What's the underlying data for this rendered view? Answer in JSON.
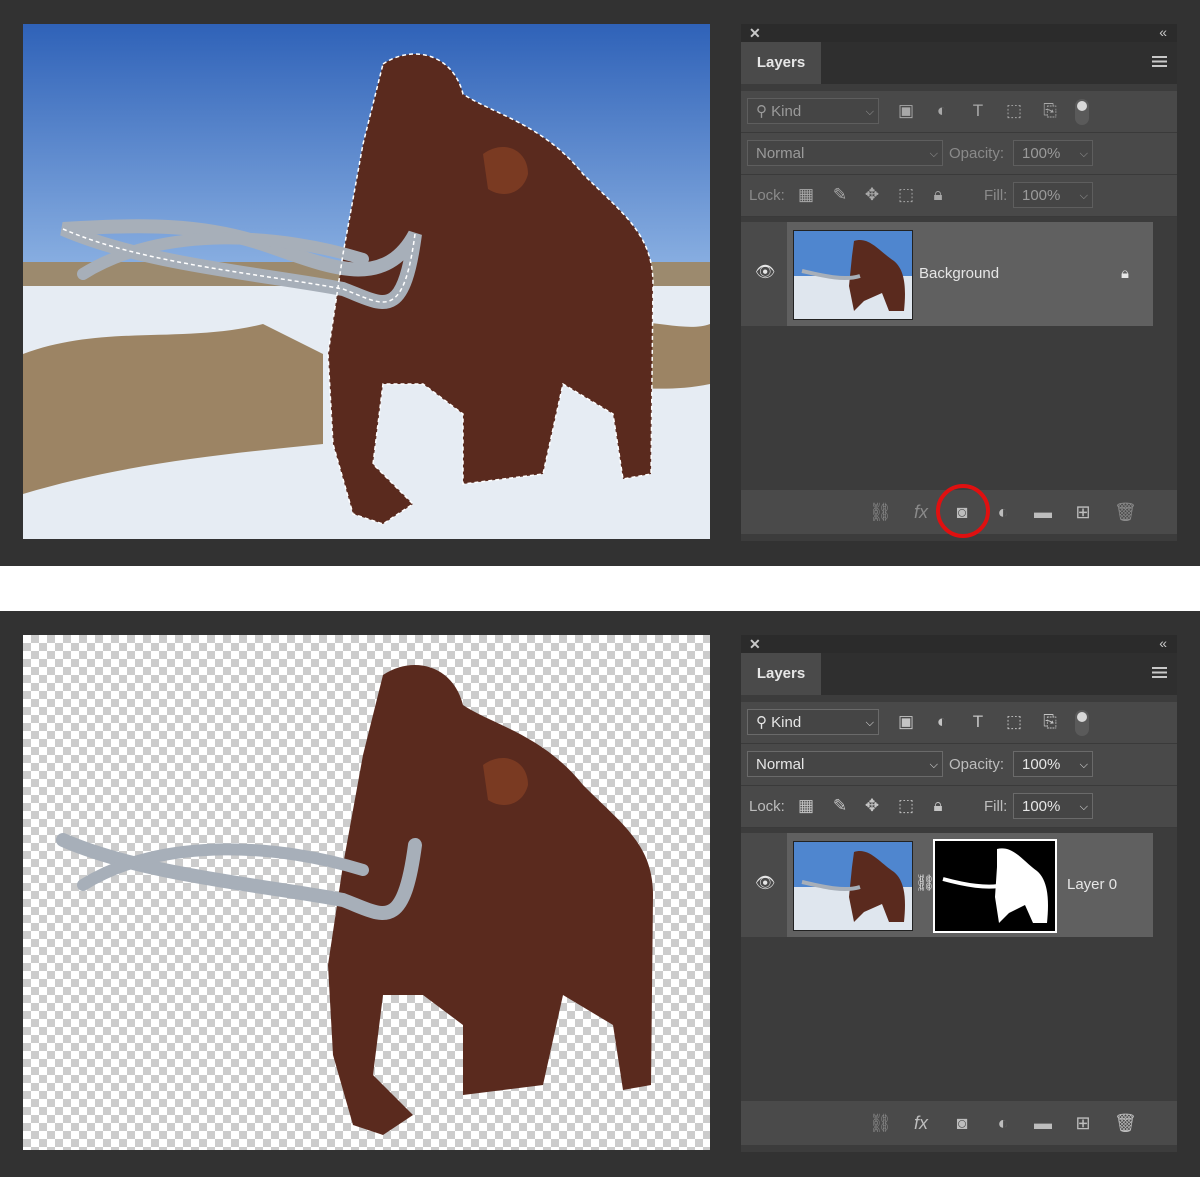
{
  "panels": [
    {
      "id": "before",
      "tab_label": "Layers",
      "kind_label": "Kind",
      "blend_mode": "Normal",
      "opacity_label": "Opacity:",
      "opacity_value": "100%",
      "lock_label": "Lock:",
      "fill_label": "Fill:",
      "fill_value": "100%",
      "layer_name": "Background",
      "controls_enabled": false,
      "highlighted_button": "add-layer-mask-button",
      "highlight_color": "#e01010"
    },
    {
      "id": "after",
      "tab_label": "Layers",
      "kind_label": "Kind",
      "blend_mode": "Normal",
      "opacity_label": "Opacity:",
      "opacity_value": "100%",
      "lock_label": "Lock:",
      "fill_label": "Fill:",
      "fill_value": "100%",
      "layer_name": "Layer 0",
      "controls_enabled": true
    }
  ],
  "icons": {
    "filter": [
      "image-filter-icon",
      "adjustment-filter-icon",
      "type-filter-icon",
      "shape-filter-icon",
      "smart-object-filter-icon"
    ],
    "lock": [
      "lock-transparent-icon",
      "lock-paint-icon",
      "lock-position-icon",
      "lock-artboard-icon",
      "lock-all-icon"
    ],
    "footer": [
      "link-layers-icon",
      "fx-icon",
      "add-mask-icon",
      "adjustment-layer-icon",
      "group-folder-icon",
      "new-layer-icon",
      "trash-icon"
    ]
  },
  "colors": {
    "workspace": "#323232",
    "panel": "#3c3c3c",
    "selected_layer": "#606060",
    "sky": "#4f86cf",
    "mammoth": "#5a2a1e",
    "tusk": "#9aa3ae"
  }
}
